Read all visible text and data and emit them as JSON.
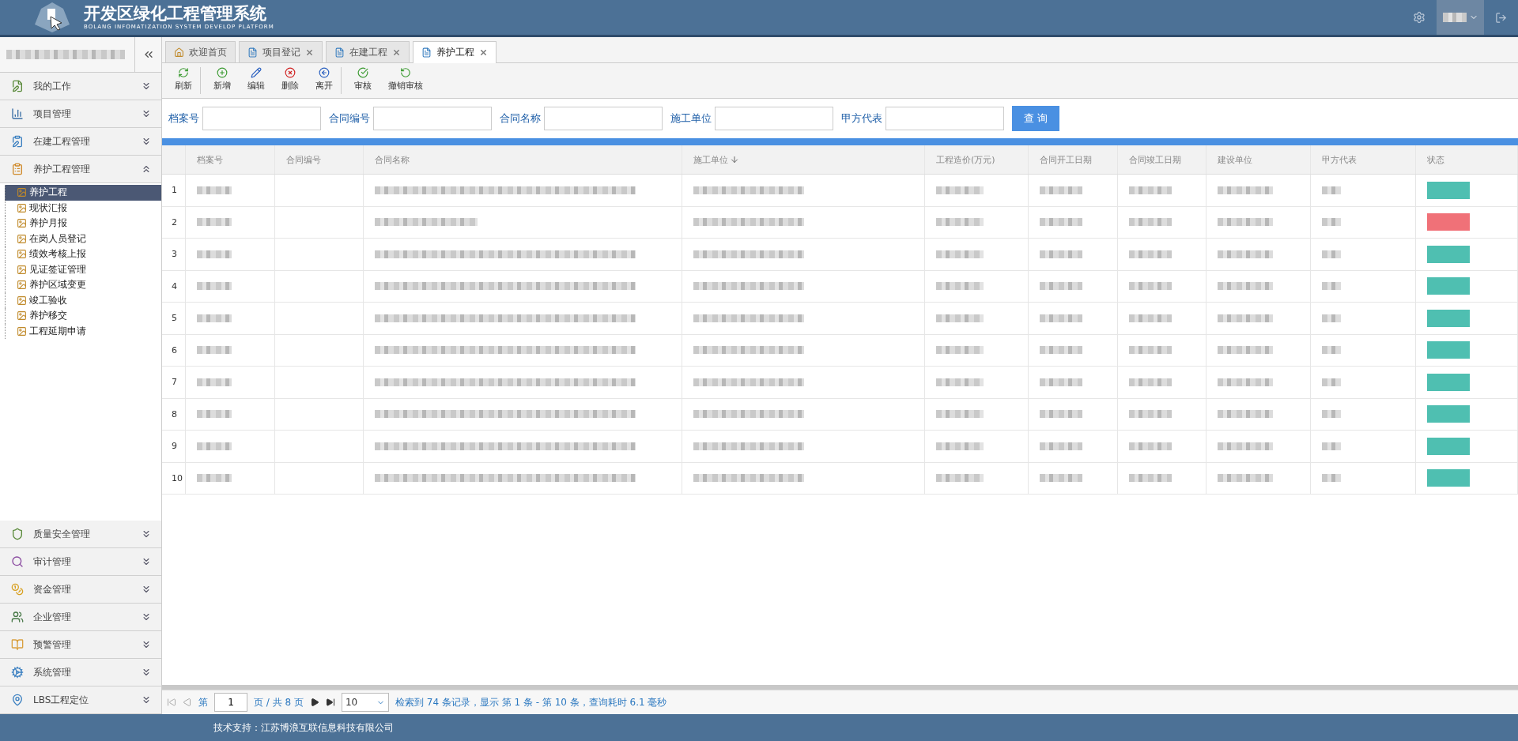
{
  "header": {
    "title": "开发区绿化工程管理系统",
    "subtitle": "BOLANG INFOMATIZATION SYSTEM DEVELOP PLATFORM"
  },
  "sidebar": {
    "groups": [
      {
        "label": "我的工作",
        "kind": "work",
        "expanded": false
      },
      {
        "label": "项目管理",
        "kind": "project",
        "expanded": false
      },
      {
        "label": "在建工程管理",
        "kind": "build",
        "expanded": false
      },
      {
        "label": "养护工程管理",
        "kind": "care",
        "expanded": true,
        "children": [
          {
            "label": "养护工程",
            "selected": true
          },
          {
            "label": "现状汇报",
            "selected": false
          },
          {
            "label": "养护月报",
            "selected": false
          },
          {
            "label": "在岗人员登记",
            "selected": false
          },
          {
            "label": "绩效考核上报",
            "selected": false
          },
          {
            "label": "见证签证管理",
            "selected": false
          },
          {
            "label": "养护区域变更",
            "selected": false
          },
          {
            "label": "竣工验收",
            "selected": false
          },
          {
            "label": "养护移交",
            "selected": false
          },
          {
            "label": "工程延期申请",
            "selected": false
          }
        ]
      },
      {
        "label": "质量安全管理",
        "kind": "quality",
        "expanded": false
      },
      {
        "label": "审计管理",
        "kind": "audit",
        "expanded": false
      },
      {
        "label": "资金管理",
        "kind": "money",
        "expanded": false
      },
      {
        "label": "企业管理",
        "kind": "company",
        "expanded": false
      },
      {
        "label": "预警管理",
        "kind": "warning",
        "expanded": false
      },
      {
        "label": "系统管理",
        "kind": "system",
        "expanded": false
      },
      {
        "label": "LBS工程定位",
        "kind": "map",
        "expanded": false
      }
    ]
  },
  "tabs": [
    {
      "label": "欢迎首页",
      "selected": false,
      "closable": false
    },
    {
      "label": "项目登记",
      "selected": false,
      "closable": true
    },
    {
      "label": "在建工程",
      "selected": false,
      "closable": true
    },
    {
      "label": "养护工程",
      "selected": true,
      "closable": true
    }
  ],
  "toolbar": [
    {
      "label": "刷新",
      "kind": "refresh",
      "separator_after": true
    },
    {
      "label": "新增",
      "kind": "add",
      "separator_after": false
    },
    {
      "label": "编辑",
      "kind": "edit",
      "separator_after": false
    },
    {
      "label": "删除",
      "kind": "delete",
      "separator_after": false
    },
    {
      "label": "离开",
      "kind": "leave",
      "separator_after": true
    },
    {
      "label": "审核",
      "kind": "approve",
      "separator_after": false
    },
    {
      "label": "撤销审核",
      "kind": "revoke",
      "separator_after": false
    }
  ],
  "search": {
    "fields": [
      {
        "label": "档案号"
      },
      {
        "label": "合同编号"
      },
      {
        "label": "合同名称"
      },
      {
        "label": "施工单位"
      },
      {
        "label": "甲方代表"
      }
    ],
    "button": "查 询"
  },
  "table": {
    "columns": [
      {
        "label": "档案号",
        "redacted": true,
        "sorted": false
      },
      {
        "label": "合同编号",
        "redacted": false,
        "sorted": false
      },
      {
        "label": "合同名称",
        "redacted": true,
        "sorted": false
      },
      {
        "label": "施工单位",
        "redacted": true,
        "sorted": true
      },
      {
        "label": "工程造价(万元)",
        "redacted": true,
        "sorted": false
      },
      {
        "label": "合同开工日期",
        "redacted": true,
        "sorted": false
      },
      {
        "label": "合同竣工日期",
        "redacted": true,
        "sorted": false
      },
      {
        "label": "建设单位",
        "redacted": true,
        "sorted": false
      },
      {
        "label": "甲方代表",
        "redacted": true,
        "sorted": false
      },
      {
        "label": "状态",
        "sorted": false
      }
    ],
    "rows": [
      {
        "number": "1",
        "status": {
          "color": "#4fbfb1"
        }
      },
      {
        "number": "2",
        "status": {
          "color": "#f07178"
        }
      },
      {
        "number": "3",
        "status": {
          "color": "#4fbfb1"
        }
      },
      {
        "number": "4",
        "status": {
          "color": "#4fbfb1"
        }
      },
      {
        "number": "5",
        "status": {
          "color": "#4fbfb1"
        }
      },
      {
        "number": "6",
        "status": {
          "color": "#4fbfb1"
        }
      },
      {
        "number": "7",
        "status": {
          "color": "#4fbfb1"
        }
      },
      {
        "number": "8",
        "status": {
          "color": "#4fbfb1"
        }
      },
      {
        "number": "9",
        "status": {
          "color": "#4fbfb1"
        }
      },
      {
        "number": "10",
        "status": {
          "color": "#4fbfb1"
        }
      }
    ]
  },
  "pager": {
    "page_prefix": "第",
    "page": "1",
    "page_suffix": "页 / 共 8 页",
    "page_size": "10",
    "summary": "检索到 74 条记录，显示 第 1 条 - 第 10 条，查询耗时 6.1 毫秒"
  },
  "footer": "技术支持：江苏博浪互联信息科技有限公司"
}
